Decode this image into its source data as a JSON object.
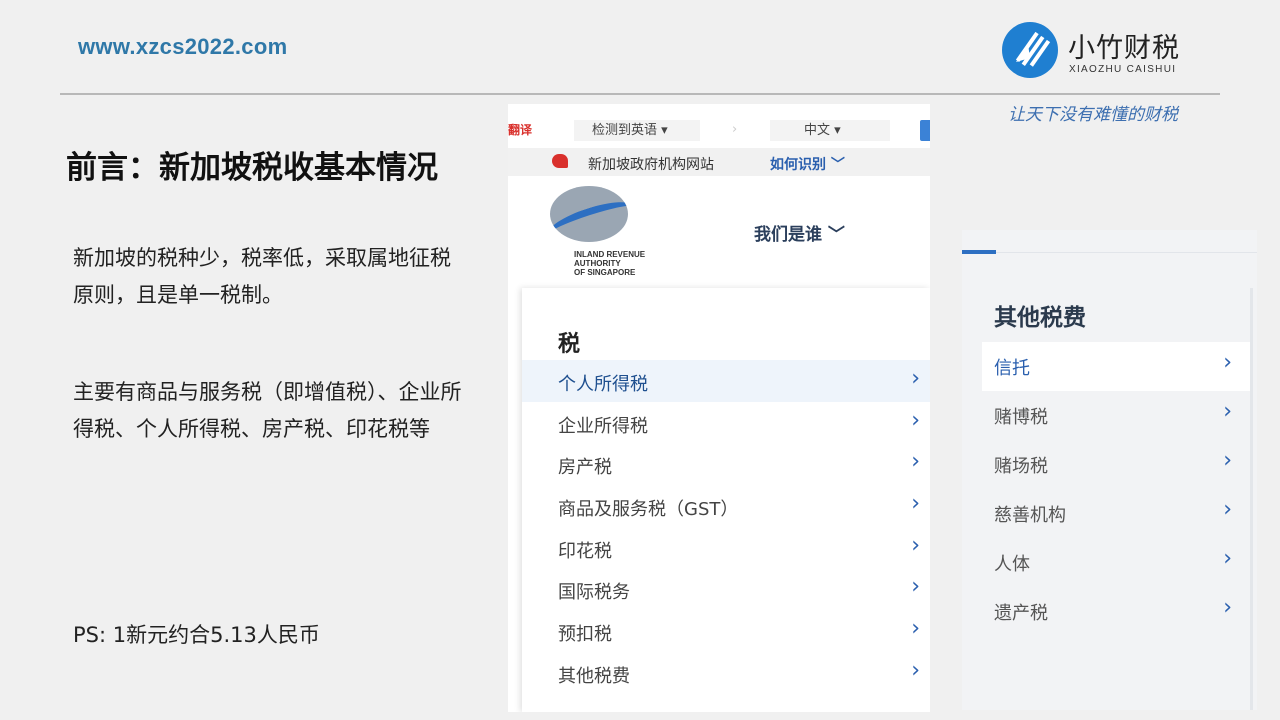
{
  "header": {
    "url": "www.xzcs2022.com",
    "brand_name": "小竹财税",
    "brand_sub": "XIAOZHU CAISHUI",
    "slogan": "让天下没有难懂的财税"
  },
  "content": {
    "title": "前言：新加坡税收基本情况",
    "paragraph_1": "新加坡的税种少，税率低，采取属地征税原则，且是单一税制。",
    "paragraph_2": "主要有商品与服务税（即增值税）、企业所得税、个人所得税、房产税、印花税等",
    "ps_note": "PS: 1新元约合5.13人民币"
  },
  "irs_screenshot": {
    "translate_label": "翻译",
    "source_lang": "检测到英语 ▾",
    "arrow": "›",
    "target_lang": "中文 ▾",
    "gov_site_text": "新加坡政府机构网站",
    "gov_identify_link": "如何识别 ﹀",
    "logo_text": "INLAND REVENUE\nAUTHORITY\nOF SINGAPORE",
    "who_we_are": "我们是谁 ﹀",
    "menu_heading": "税",
    "menu_items": [
      {
        "label": "个人所得税",
        "arrow": "›"
      },
      {
        "label": "企业所得税",
        "arrow": "›"
      },
      {
        "label": "房产税",
        "arrow": "›"
      },
      {
        "label": "商品及服务税（GST）",
        "arrow": "›"
      },
      {
        "label": "印花税",
        "arrow": "›"
      },
      {
        "label": "国际税务",
        "arrow": "›"
      },
      {
        "label": "预扣税",
        "arrow": "›"
      },
      {
        "label": "其他税费",
        "arrow": "›"
      }
    ]
  },
  "other_screenshot": {
    "heading": "其他税费",
    "items": [
      {
        "label": "信托",
        "arrow": "›"
      },
      {
        "label": "赌博税",
        "arrow": "›"
      },
      {
        "label": "赌场税",
        "arrow": "›"
      },
      {
        "label": "慈善机构",
        "arrow": "›"
      },
      {
        "label": "人体",
        "arrow": "›"
      },
      {
        "label": "遗产税",
        "arrow": "›"
      }
    ]
  },
  "colors": {
    "url_blue": "#2f78a8",
    "brand_blue": "#1f7fd1",
    "link_blue": "#2a5fae",
    "translate_red": "#d9302c"
  },
  "icons": [
    "brand-logo-icon",
    "translate-button-icon",
    "gov-lion-icon",
    "iras-logo-icon",
    "chevron-right-icon"
  ]
}
